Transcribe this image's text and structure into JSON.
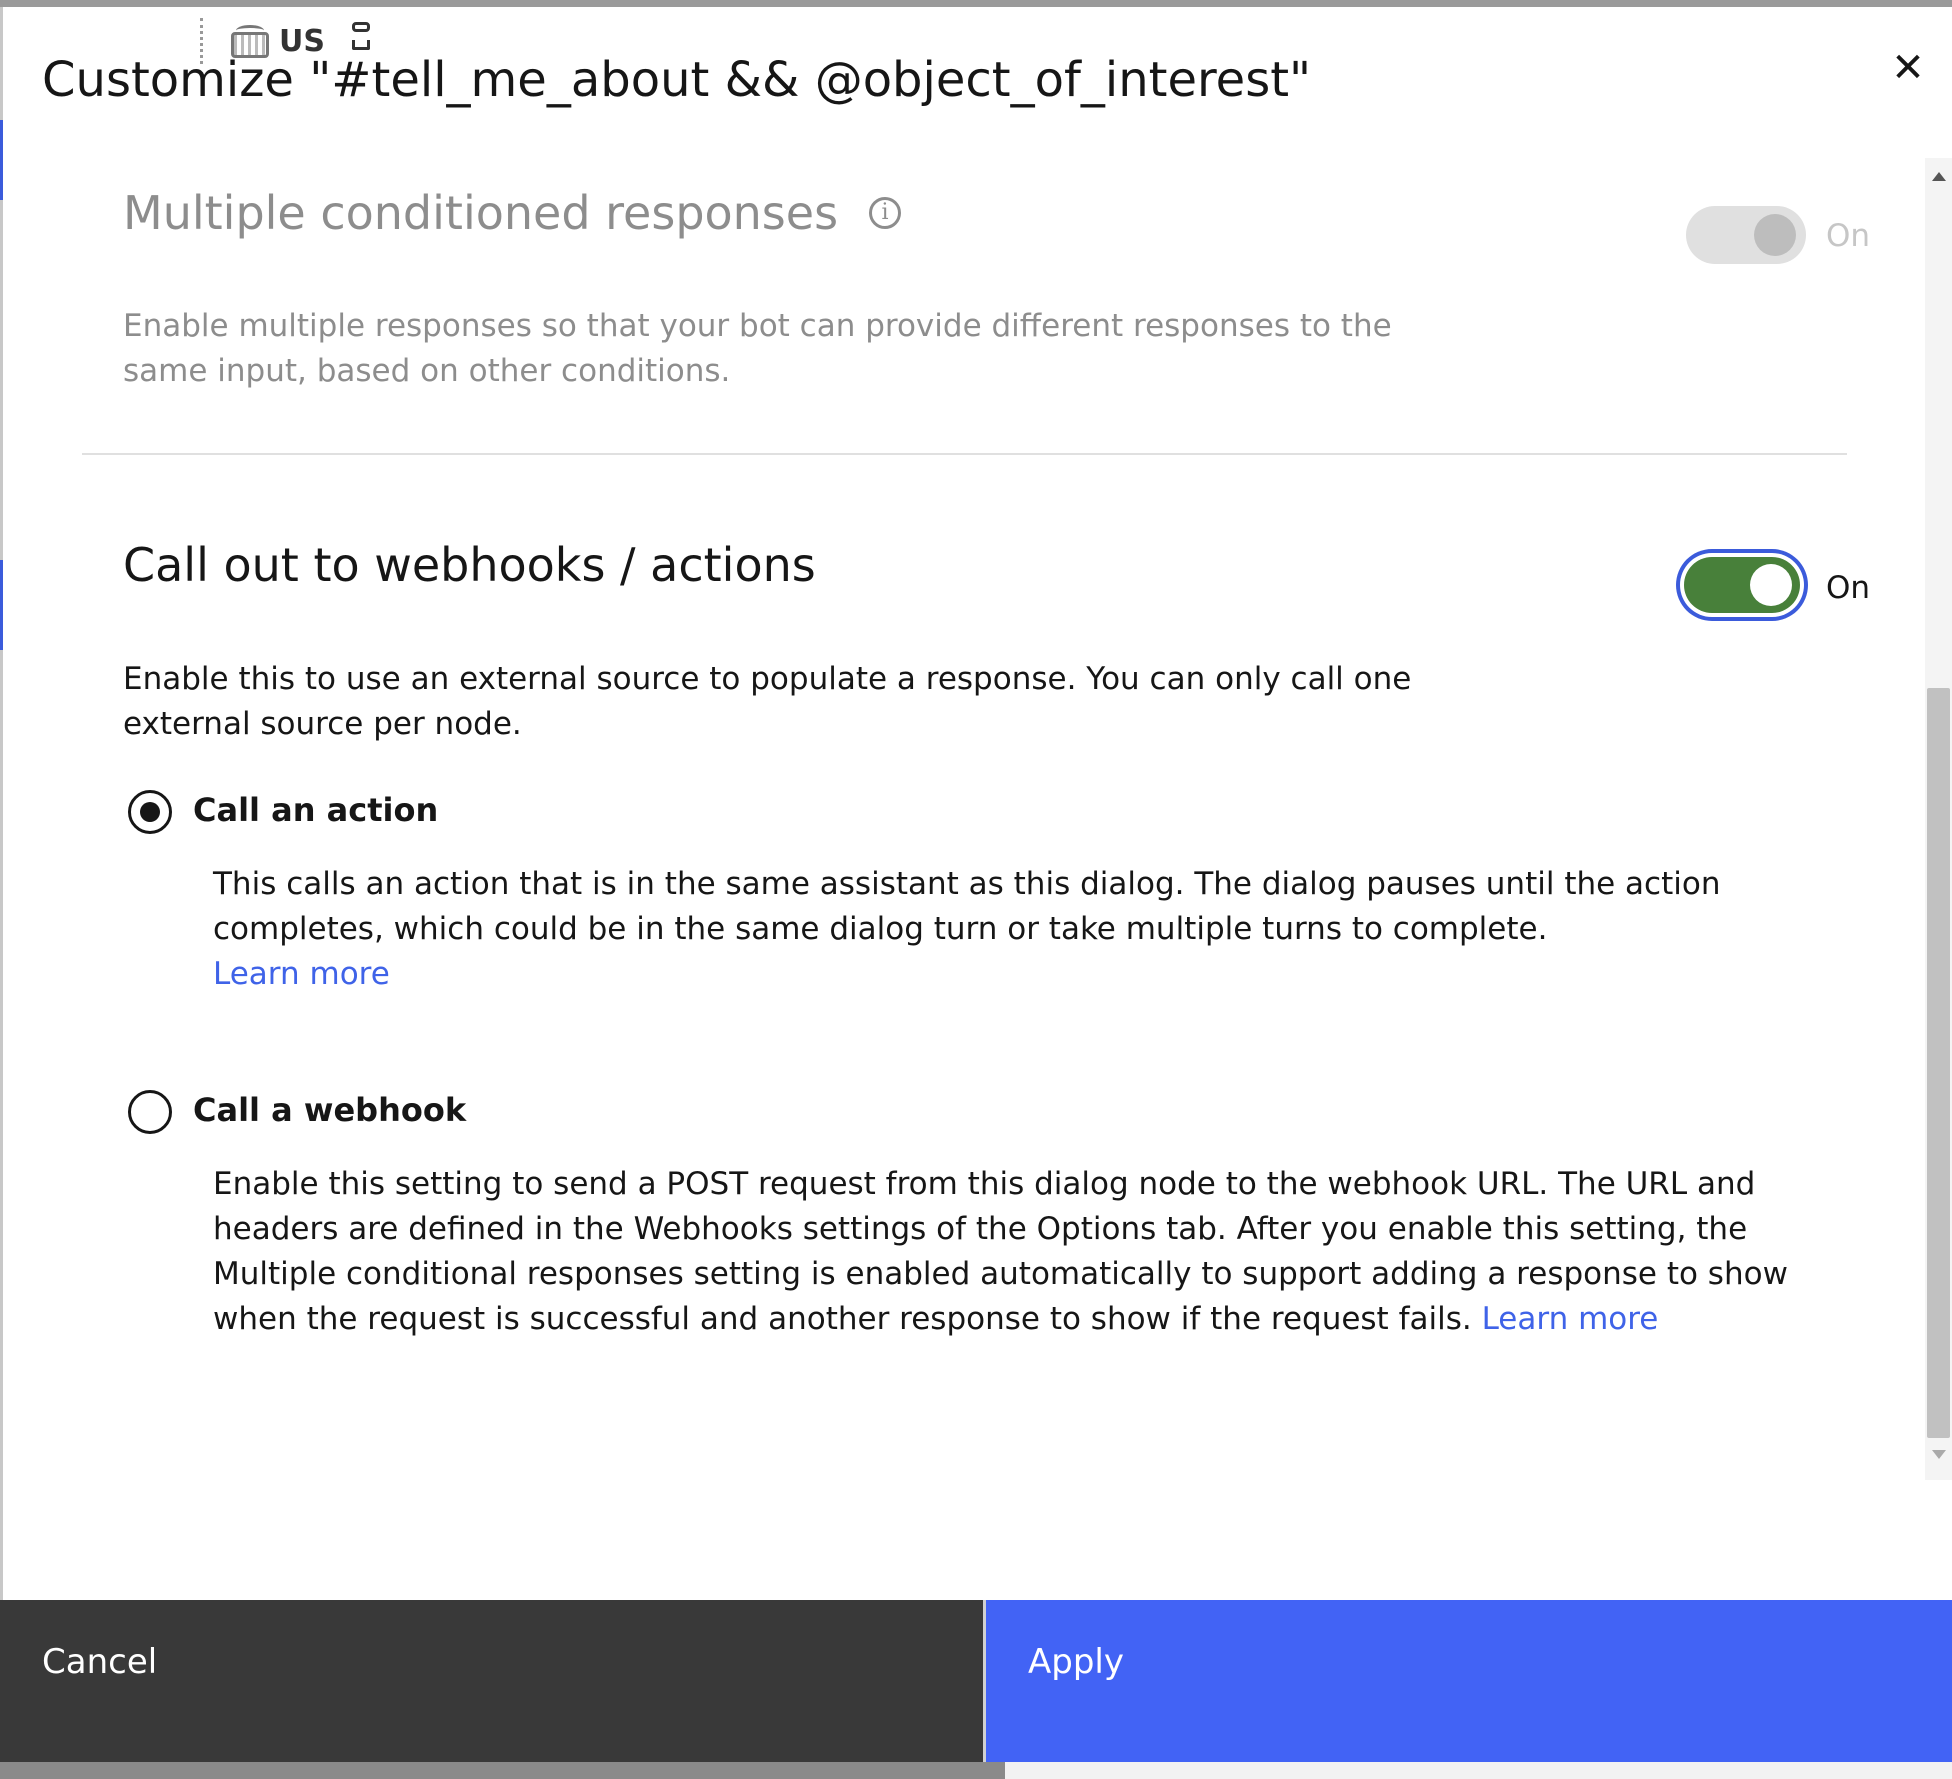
{
  "language_bar": {
    "label": "US",
    "keyboard_icon": "keyboard-icon"
  },
  "dialog": {
    "title": "Customize \"#tell_me_about && @object_of_interest\"",
    "close_icon": "close-icon"
  },
  "sections": {
    "multiple_responses": {
      "title": "Multiple conditioned responses",
      "info_icon": "info-icon",
      "toggle_label": "On",
      "toggle_state": "on-disabled",
      "description": "Enable multiple responses so that your bot can provide different responses to the same input, based on other conditions."
    },
    "webhooks": {
      "title": "Call out to webhooks / actions",
      "toggle_label": "On",
      "toggle_state": "on",
      "description": "Enable this to use an external source to populate a response. You can only call one external source per node.",
      "options": [
        {
          "label": "Call an action",
          "selected": true,
          "description": "This calls an action that is in the same assistant as this dialog. The dialog pauses until the action completes, which could be in the same dialog turn or take multiple turns to complete.",
          "link": "Learn more"
        },
        {
          "label": "Call a webhook",
          "selected": false,
          "description": "Enable this setting to send a POST request from this dialog node to the webhook URL. The URL and headers are defined in the Webhooks settings of the Options tab. After you enable this setting, the Multiple conditional responses setting is enabled automatically to support adding a response to show when the request is successful and another response to show if the request fails.",
          "link": "Learn more"
        }
      ]
    }
  },
  "footer": {
    "cancel_label": "Cancel",
    "apply_label": "Apply"
  },
  "colors": {
    "toggle_on": "#48803a",
    "focus_ring": "#3b5bdb",
    "primary_button": "#4263f5",
    "secondary_button": "#393939",
    "link": "#3f63e8"
  }
}
